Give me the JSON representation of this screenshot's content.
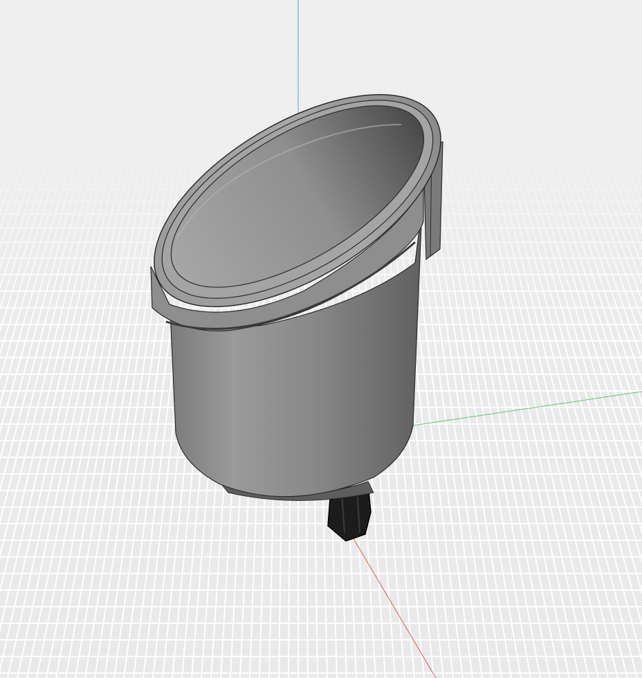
{
  "viewport": {
    "background_color": "#ececec",
    "grid_color": "#ffffff",
    "axes": {
      "z_axis_color": "#7fa7e6",
      "x_axis_color": "#e05a5a",
      "y_axis_color": "#66c07a"
    }
  },
  "model": {
    "body_color": "#8c8c8c",
    "rim_color": "#9a9a9a",
    "edge_color": "#2a2a2a",
    "clip_color": "#1a1a1a"
  }
}
